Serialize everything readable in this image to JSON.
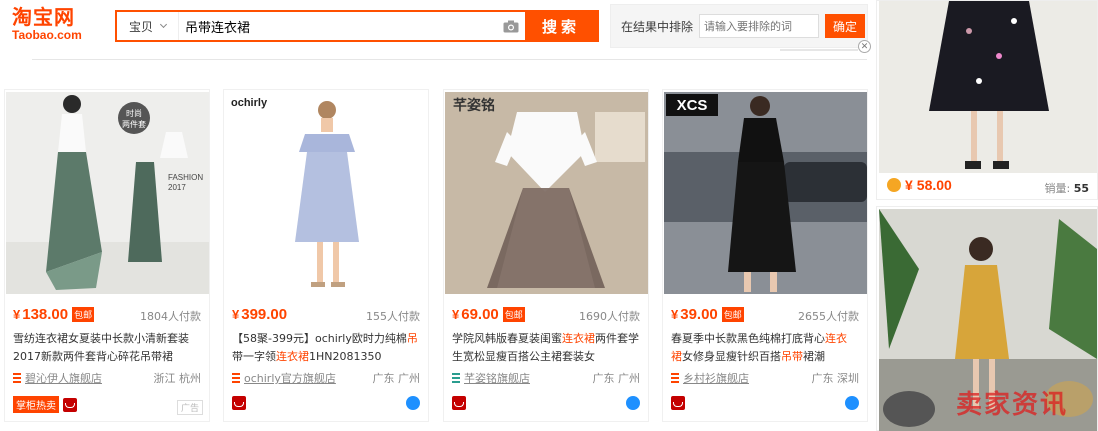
{
  "header": {
    "logo_cn": "淘宝网",
    "logo_en": "Taobao.com",
    "search": {
      "scope": "宝贝",
      "query": "吊带连衣裙",
      "button": "搜索"
    },
    "exclude": {
      "label": "在结果中排除",
      "placeholder": "请输入要排除的词",
      "button": "确定"
    }
  },
  "products": [
    {
      "price_currency": "¥",
      "price": "138.00",
      "free_shipping": "包邮",
      "paid": "1804人付款",
      "title_html_parts": [
        "雪纺连衣裙女夏装中长款小清新套装2017新款两件套背心碎花吊带裙"
      ],
      "shop": "碧沁伊人旗舰店",
      "location": "浙江 杭州",
      "badge": "掌柜热卖",
      "ad": "广告",
      "image_text": [
        "时尚",
        "两件套",
        "FASHION",
        "2017"
      ]
    },
    {
      "price_currency": "¥",
      "price": "399.00",
      "paid": "155人付款",
      "title_a": "【58聚-399元】ochirly欧时力纯棉",
      "title_hl1": "吊",
      "title_b": "带一字领",
      "title_hl2": "连衣裙",
      "title_c": "1HN2081350",
      "shop": "ochirly官方旗舰店",
      "location": "广东 广州",
      "image_text": [
        "ochirly"
      ]
    },
    {
      "price_currency": "¥",
      "price": "69.00",
      "free_shipping": "包邮",
      "paid": "1690人付款",
      "title_a": "学院风韩版春夏装闺蜜",
      "title_hl": "连衣裙",
      "title_b": "两件套学生宽松显瘦百搭公主裙套装女",
      "shop": "芊姿铭旗舰店",
      "location": "广东 广州",
      "image_text": [
        "芊姿铭"
      ]
    },
    {
      "price_currency": "¥",
      "price": "39.00",
      "free_shipping": "包邮",
      "paid": "2655人付款",
      "title_a": "春夏季中长款黑色纯棉打底背心",
      "title_hl1": "连衣",
      "title_hl2": "裙",
      "title_b": "女修身显瘦针织百搭",
      "title_hl3": "吊带",
      "title_c": "裙潮",
      "shop": "乡村衫旗舰店",
      "location": "广东 深圳",
      "image_text": [
        "XCS"
      ]
    }
  ],
  "side": {
    "price_currency": "¥",
    "price": "58.00",
    "sales_label": "销量:",
    "sales": "55"
  },
  "watermark": "卖家资讯",
  "colors": {
    "brand": "#ff5000",
    "price": "#ff4400",
    "tmall": "#c40000"
  }
}
